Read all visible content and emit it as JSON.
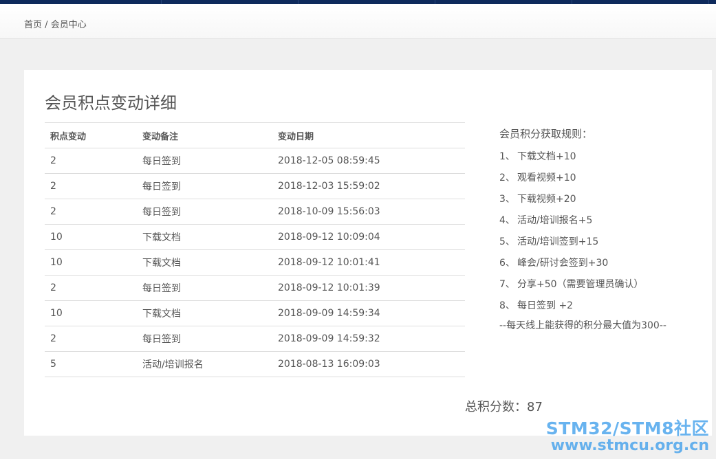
{
  "breadcrumb": {
    "home": "首页",
    "separator": "/",
    "current": "会员中心"
  },
  "page_title": "会员积点变动详细",
  "table": {
    "headers": [
      "积点变动",
      "变动备注",
      "变动日期"
    ],
    "rows": [
      [
        "2",
        "每日签到",
        "2018-12-05 08:59:45"
      ],
      [
        "2",
        "每日签到",
        "2018-12-03 15:59:02"
      ],
      [
        "2",
        "每日签到",
        "2018-10-09 15:56:03"
      ],
      [
        "10",
        "下载文档",
        "2018-09-12 10:09:04"
      ],
      [
        "10",
        "下载文档",
        "2018-09-12 10:01:41"
      ],
      [
        "2",
        "每日签到",
        "2018-09-12 10:01:39"
      ],
      [
        "10",
        "下载文档",
        "2018-09-09 14:59:34"
      ],
      [
        "2",
        "每日签到",
        "2018-09-09 14:59:32"
      ],
      [
        "5",
        "活动/培训报名",
        "2018-08-13 16:09:03"
      ]
    ]
  },
  "rules": {
    "title": "会员积分获取规则：",
    "items": [
      {
        "no": "1、",
        "text": "下载文档+10"
      },
      {
        "no": "2、",
        "text": "观看视频+10"
      },
      {
        "no": "3、",
        "text": "下载视频+20"
      },
      {
        "no": "4、",
        "text": "活动/培训报名+5"
      },
      {
        "no": "5、",
        "text": "活动/培训签到+15"
      },
      {
        "no": "6、",
        "text": "峰会/研讨会签到+30"
      },
      {
        "no": "7、",
        "text": "分享+50（需要管理员确认）"
      },
      {
        "no": "8、",
        "text": "每日签到 +2"
      }
    ],
    "note": "--每天线上能获得的积分最大值为300--"
  },
  "total": {
    "label": "总积分数：",
    "value": "87"
  },
  "watermark": {
    "line1": "STM32/STM8社区",
    "line2": "www.stmcu.org.cn"
  },
  "colors": {
    "topbar": "#0e2a5c",
    "watermark": "#42a0eb"
  }
}
